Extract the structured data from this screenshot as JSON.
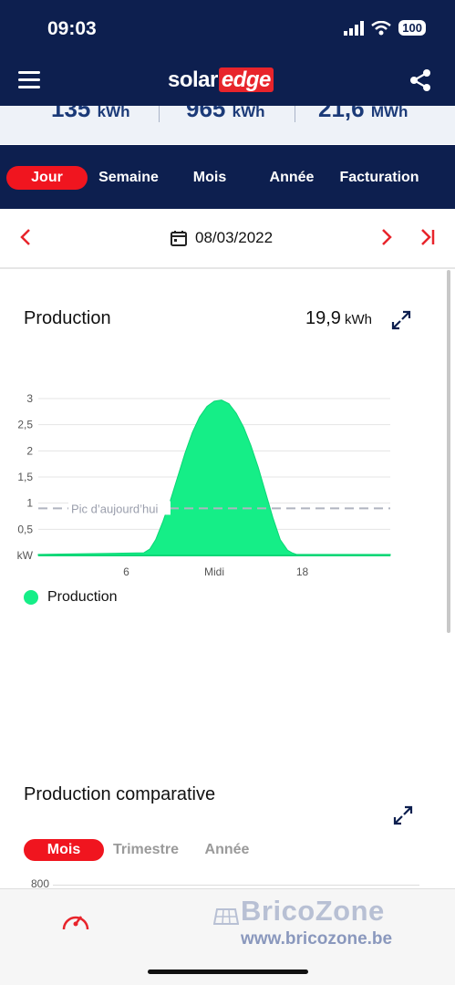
{
  "status": {
    "time": "09:03",
    "battery": "100"
  },
  "app": {
    "logo_solar": "solar",
    "logo_edge": "edge"
  },
  "summary": [
    {
      "value": "135",
      "unit": "kWh"
    },
    {
      "value": "965",
      "unit": "kWh"
    },
    {
      "value": "21,6",
      "unit": "MWh"
    }
  ],
  "tabs": [
    "Jour",
    "Semaine",
    "Mois",
    "Année",
    "Facturation"
  ],
  "active_tab": "Jour",
  "date": "08/03/2022",
  "production": {
    "title": "Production",
    "total_value": "19,9",
    "total_unit": "kWh",
    "legend": "Production",
    "peak_label": "Pic d’aujourd’hui"
  },
  "comparative": {
    "title": "Production comparative",
    "tabs": [
      "Mois",
      "Trimestre",
      "Année"
    ],
    "y_top": "800"
  },
  "watermark": {
    "brand": "BricoZone",
    "url": "www.bricozone.be"
  },
  "colors": {
    "navy": "#0d1f4f",
    "accent_red": "#f0151f",
    "production_green": "#15ee87"
  },
  "chart_data": {
    "type": "area",
    "x_ticks": [
      {
        "x": 6,
        "label": "6"
      },
      {
        "x": 12,
        "label": "Midi"
      },
      {
        "x": 18,
        "label": "18"
      }
    ],
    "y_ticks": [
      {
        "y": 0,
        "label": "kW"
      },
      {
        "y": 0.5,
        "label": "0,5"
      },
      {
        "y": 1,
        "label": "1"
      },
      {
        "y": 1.5,
        "label": "1,5"
      },
      {
        "y": 2,
        "label": "2"
      },
      {
        "y": 2.5,
        "label": "2,5"
      },
      {
        "y": 3,
        "label": "3"
      }
    ],
    "xlim": [
      0,
      24
    ],
    "ylim": [
      0,
      3
    ],
    "peak_line_y": 0.9,
    "grid": true,
    "series": [
      {
        "name": "Production",
        "x": [
          0,
          7.2,
          7.6,
          8,
          8.5,
          9,
          9.5,
          10,
          10.5,
          11,
          11.5,
          12,
          12.5,
          13,
          13.5,
          14,
          14.5,
          15,
          15.5,
          16,
          16.5,
          17,
          17.3,
          17.6,
          24
        ],
        "y": [
          0.02,
          0.05,
          0.12,
          0.3,
          0.65,
          1.05,
          1.5,
          1.95,
          2.35,
          2.65,
          2.85,
          2.95,
          2.97,
          2.9,
          2.72,
          2.45,
          2.1,
          1.68,
          1.2,
          0.72,
          0.3,
          0.1,
          0.05,
          0.02,
          0.02
        ]
      }
    ]
  }
}
